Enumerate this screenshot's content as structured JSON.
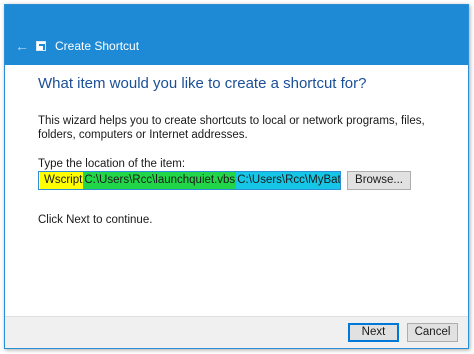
{
  "window": {
    "title": "Create Shortcut"
  },
  "main": {
    "heading": "What item would you like to create a shortcut for?",
    "description": "This wizard helps you to create shortcuts to local or network programs, files, folders, computers or Internet addresses.",
    "location_label": "Type the location of the item:",
    "location_input": {
      "segments": [
        "Wscript",
        "C:\\Users\\Rcc\\launchquiet.vbs",
        "C:\\Users\\Rcc\\MyBatchFile.bat"
      ]
    },
    "browse_label": "Browse...",
    "hint": "Click Next to continue."
  },
  "footer": {
    "next_label": "Next",
    "cancel_label": "Cancel"
  },
  "colors": {
    "titlebar": "#1e8ad6",
    "heading": "#1b4f96",
    "highlight_1": "#ffff00",
    "highlight_2": "#22d64a",
    "highlight_3": "#16c6e6"
  },
  "icons": {
    "back": "back-arrow-icon",
    "app": "shortcut-icon"
  }
}
